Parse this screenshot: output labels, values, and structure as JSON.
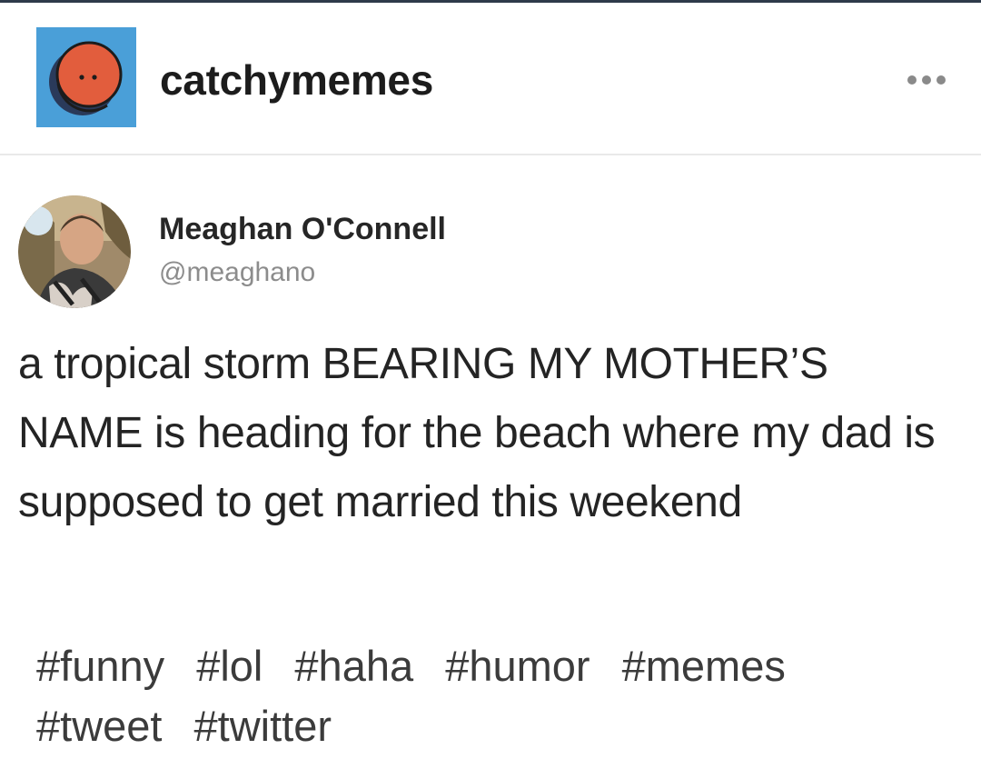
{
  "blog": {
    "name": "catchymemes",
    "avatar_icon": "smiley-face-icon",
    "avatar_bg": "#4a9fd8",
    "avatar_face": "#e25d3d"
  },
  "menu": {
    "icon": "more-options-icon"
  },
  "tweet": {
    "author_name": "Meaghan O'Connell",
    "handle": "@meaghano",
    "text": "a tropical storm BEARING MY MOTHER’S NAME is heading for the beach where my dad is supposed to get married this weekend"
  },
  "tags": [
    "#funny",
    "#lol",
    "#haha",
    "#humor",
    "#memes",
    "#tweet",
    "#twitter"
  ]
}
